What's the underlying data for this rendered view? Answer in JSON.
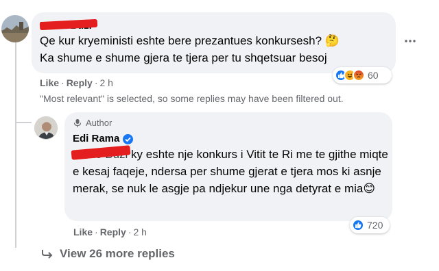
{
  "comment": {
    "author": "Mario Buzi",
    "lines": [
      "Qe kur kryeministi eshte bere prezantues konkursesh?",
      "Ka shume e shume gjera te tjera per tu shqetsuar besoj"
    ],
    "emoji": "🤔",
    "actions": {
      "like": "Like",
      "reply": "Reply",
      "time": "2 h"
    },
    "reactions": {
      "count": "60",
      "types": [
        "like",
        "haha",
        "angry"
      ]
    }
  },
  "filter_notice": "\"Most relevant\" is selected, so some replies may have been filtered out.",
  "reply": {
    "badge": "Author",
    "author": "Edi Rama",
    "mention": "Mario Buzi",
    "text": " ky eshte nje konkurs i Vitit te Ri me te gjithe miqte e kesaj faqeje, ndersa per shume gjerat e tjera mos ki asnje merak, se nuk le asgje pa ndjekur une nga detyrat e mia",
    "emoji": "😊",
    "actions": {
      "like": "Like",
      "reply": "Reply",
      "time": "2 h"
    },
    "reactions": {
      "count": "720",
      "types": [
        "like"
      ]
    }
  },
  "view_more": "View 26 more replies",
  "colors": {
    "like_blue": "#1877f2",
    "haha_yellow": "#f7b125",
    "angry_orange": "#e9710f",
    "bubble": "#f0f2f5",
    "meta_gray": "#65676b",
    "redact_red": "#e41e1e"
  }
}
